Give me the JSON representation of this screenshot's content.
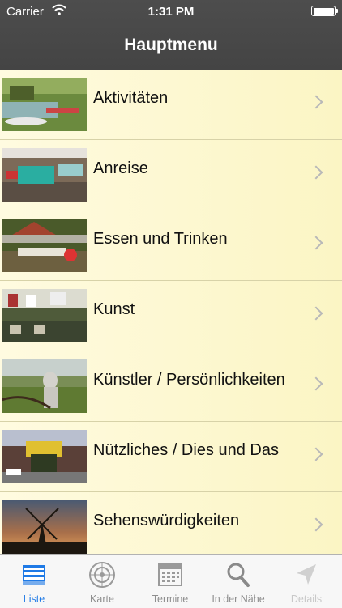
{
  "status": {
    "carrier": "Carrier",
    "time": "1:31 PM"
  },
  "nav": {
    "title": "Hauptmenu"
  },
  "menu": [
    {
      "label": "Aktivitäten",
      "icon": "chevron-right-icon"
    },
    {
      "label": "Anreise",
      "icon": "chevron-right-icon"
    },
    {
      "label": "Essen und Trinken",
      "icon": "chevron-right-icon"
    },
    {
      "label": "Kunst",
      "icon": "chevron-right-icon"
    },
    {
      "label": "Künstler / Persönlichkeiten",
      "icon": "chevron-right-icon"
    },
    {
      "label": "Nützliches / Dies und Das",
      "icon": "chevron-right-icon"
    },
    {
      "label": "Sehenswürdigkeiten",
      "icon": "chevron-right-icon"
    }
  ],
  "tabs": [
    {
      "label": "Liste",
      "icon": "list-icon",
      "state": "active"
    },
    {
      "label": "Karte",
      "icon": "radar-icon",
      "state": "normal"
    },
    {
      "label": "Termine",
      "icon": "calendar-icon",
      "state": "normal"
    },
    {
      "label": "In der Nähe",
      "icon": "search-icon",
      "state": "normal"
    },
    {
      "label": "Details",
      "icon": "location-arrow-icon",
      "state": "disabled"
    }
  ],
  "colors": {
    "accent": "#1f7ae6",
    "navbar": "#4a4a4a",
    "row_bg": "#fbf5c4"
  }
}
